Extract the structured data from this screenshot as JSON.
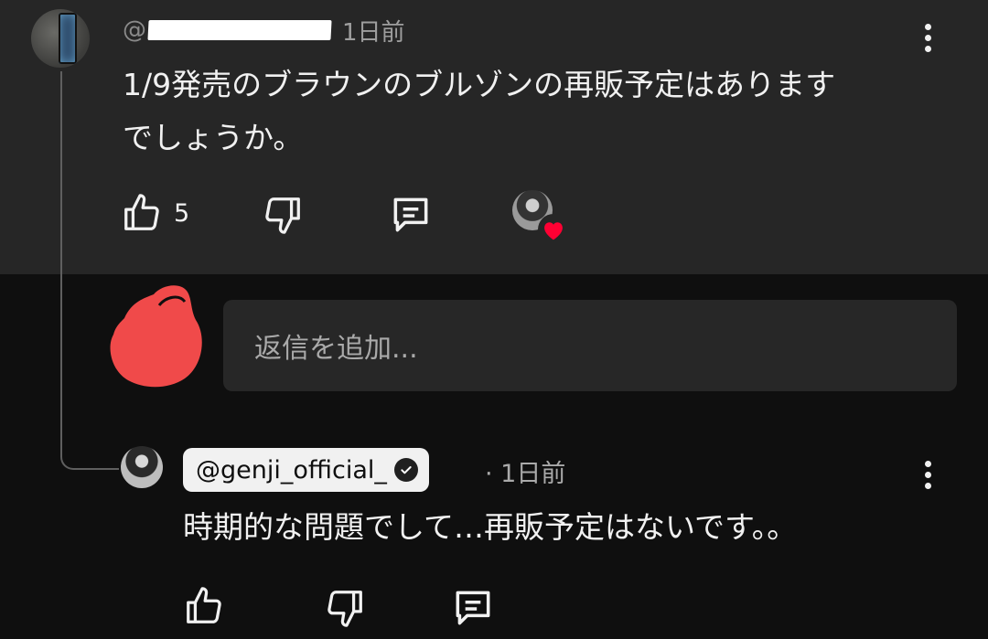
{
  "top_comment": {
    "author_prefix": "@",
    "time_ago": "1日前",
    "text_line1": "1/9発売のブラウンのブルゾンの再販予定はあります",
    "text_line2": "でしょうか。",
    "like_count": "5",
    "icons": [
      "thumbs-up-icon",
      "thumbs-down-icon",
      "reply-icon",
      "creator-heart-icon"
    ]
  },
  "reply_box": {
    "placeholder": "返信を追加..."
  },
  "reply_comment": {
    "author": "@genji_official_",
    "time_ago": "· 1日前",
    "text": "時期的な問題でして…再販予定はないです。。"
  },
  "colors": {
    "highlight_bg": "#262626",
    "page_bg": "#0f0f0f",
    "heart": "#ff0033",
    "redaction_blob": "#f04a4a"
  }
}
